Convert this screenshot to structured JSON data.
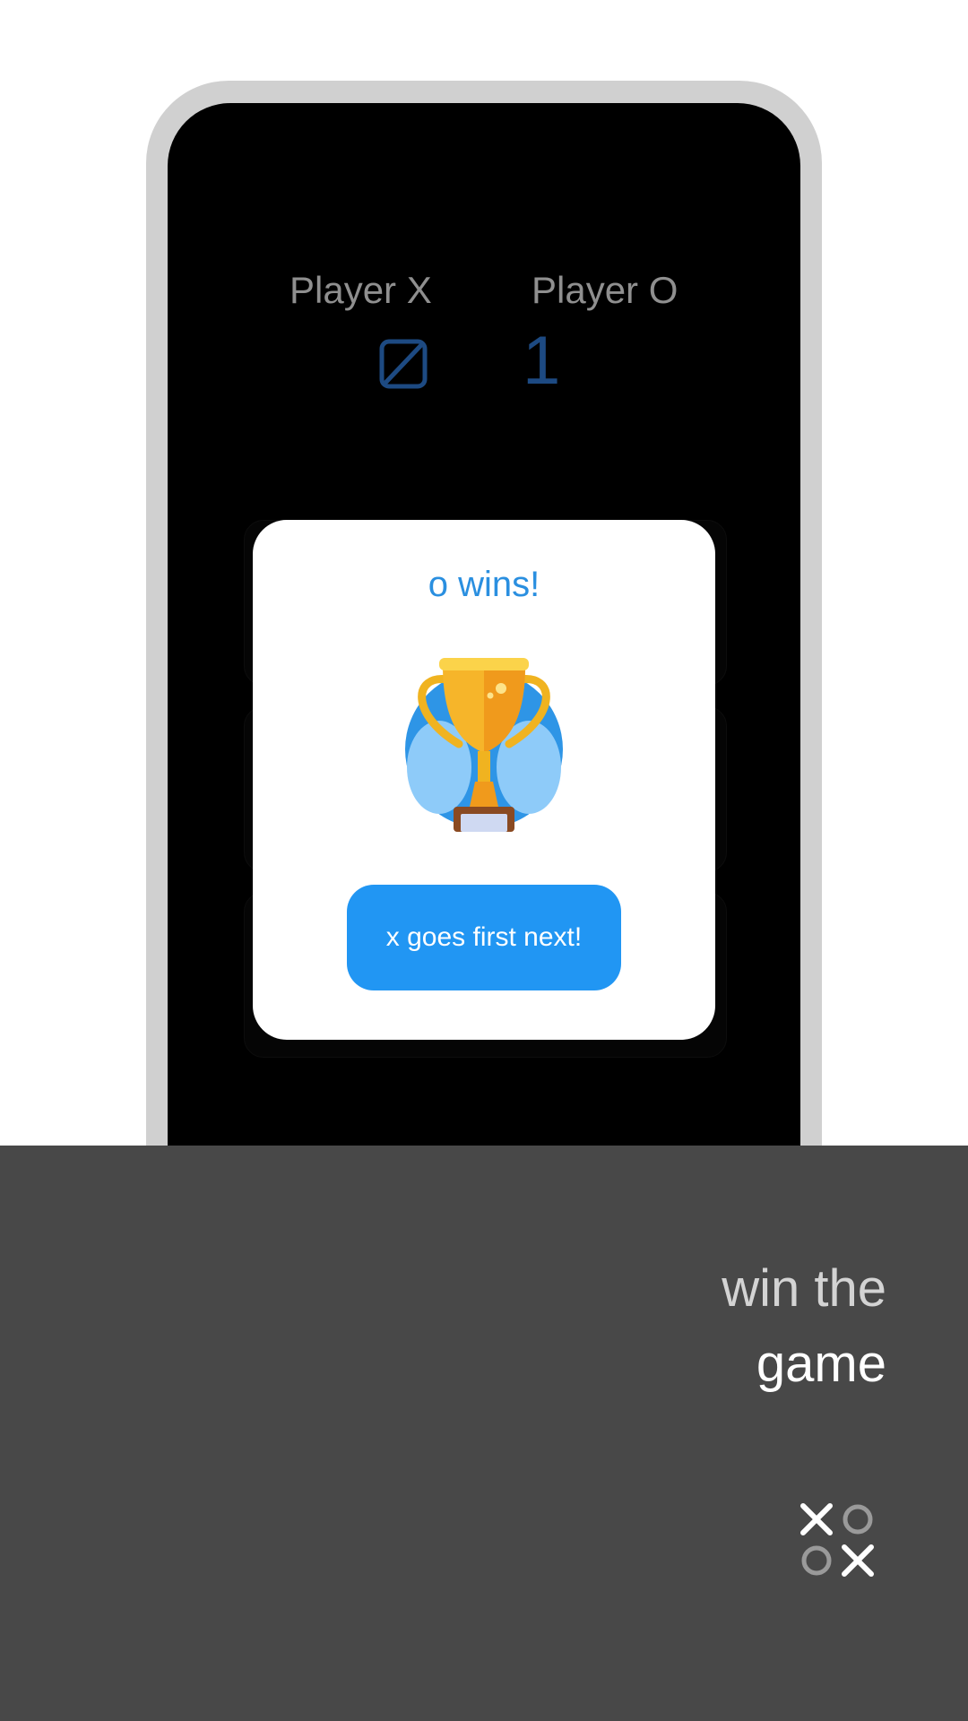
{
  "scoreboard": {
    "player_x_label": "Player X",
    "player_o_label": "Player O",
    "player_x_score": "0",
    "player_o_score": "1"
  },
  "modal": {
    "title": "o wins!",
    "trophy_icon": "trophy-icon",
    "button_label": "x goes first next!"
  },
  "promo": {
    "line1": "win the",
    "line2": "game",
    "logo_icon": "tic-tac-toe-logo-icon"
  },
  "colors": {
    "accent": "#2196f3",
    "title_blue": "#2a8fe0",
    "score_blue": "#1d4a82",
    "panel": "#484848",
    "screen": "#000000",
    "frame": "#d0d0d0"
  }
}
